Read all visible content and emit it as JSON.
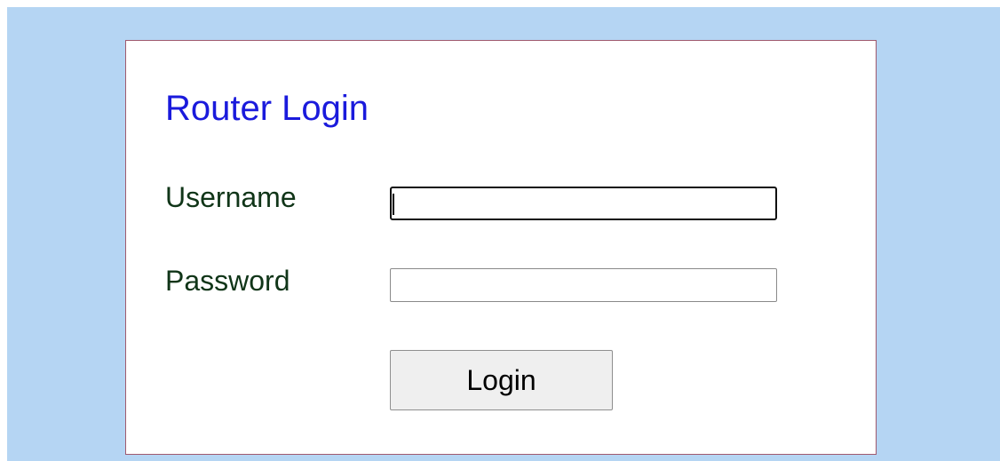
{
  "login_form": {
    "title": "Router Login",
    "username_label": "Username",
    "username_value": "",
    "password_label": "Password",
    "password_value": "",
    "login_button_label": "Login"
  },
  "colors": {
    "page_background": "#b5d5f3",
    "panel_background": "#ffffff",
    "panel_border": "#a05a6e",
    "title_color": "#1a1adc",
    "label_color": "#103518",
    "button_background": "#efefef"
  }
}
